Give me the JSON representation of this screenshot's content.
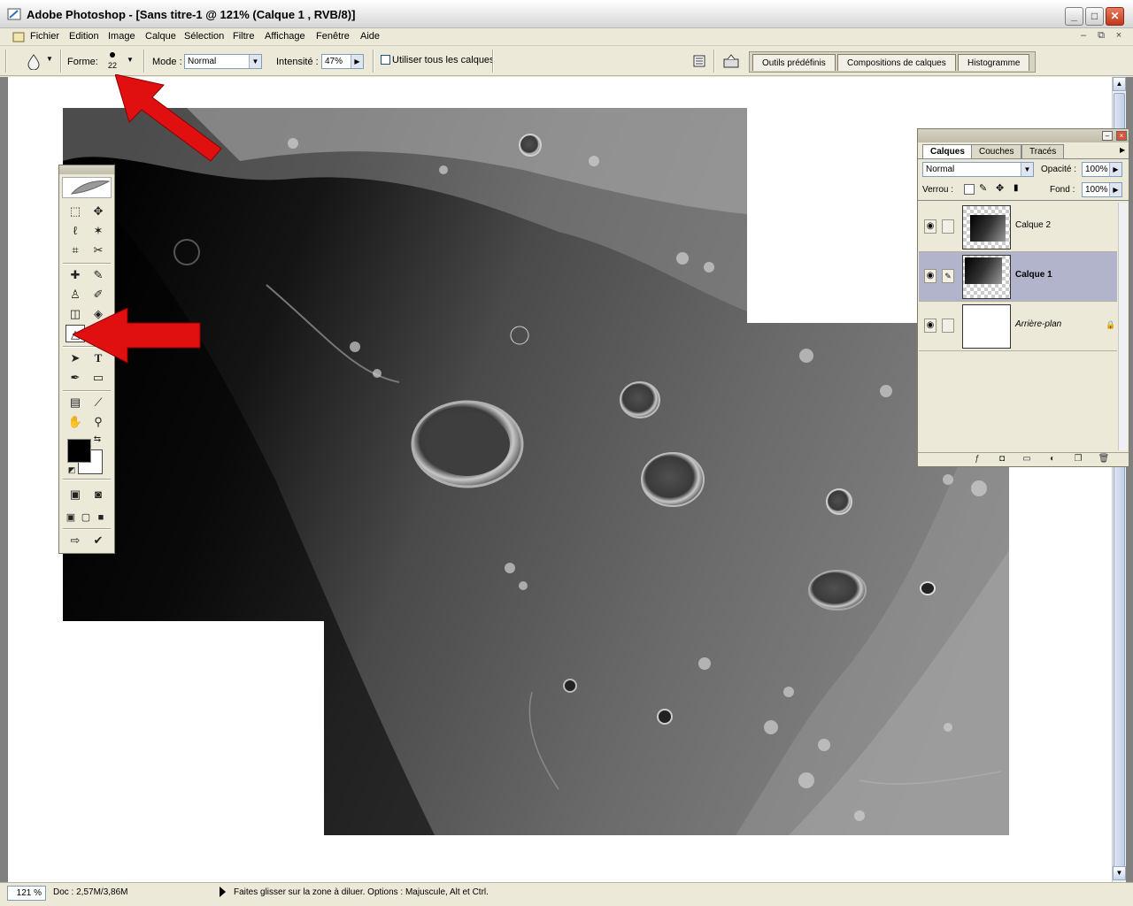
{
  "window": {
    "title": "Adobe Photoshop - [Sans titre-1 @ 121% (Calque 1 , RVB/8)]",
    "minimize": "_",
    "maximize": "□",
    "close": "✕"
  },
  "menu": {
    "items": [
      "Fichier",
      "Edition",
      "Image",
      "Calque",
      "Sélection",
      "Filtre",
      "Affichage",
      "Fenêtre",
      "Aide"
    ],
    "mdi_minimize": "–",
    "mdi_restore": "⧉",
    "mdi_close": "×"
  },
  "options": {
    "forme_label": "Forme:",
    "brush_size": "22",
    "mode_label": "Mode :",
    "mode_value": "Normal",
    "intensite_label": "Intensité :",
    "intensite_value": "47%",
    "sample_all_label": "Utiliser tous les calques",
    "well_tabs": [
      "Outils prédéfinis",
      "Compositions de calques",
      "Histogramme"
    ]
  },
  "layers_palette": {
    "tabs": [
      "Calques",
      "Couches",
      "Tracés"
    ],
    "blend_mode": "Normal",
    "opacity_label": "Opacité :",
    "opacity_value": "100%",
    "lock_label": "Verrou :",
    "fill_label": "Fond :",
    "fill_value": "100%",
    "layers": [
      {
        "name": "Calque 2",
        "selected": false
      },
      {
        "name": "Calque 1",
        "selected": true
      },
      {
        "name": "Arrière-plan",
        "selected": false
      }
    ]
  },
  "status": {
    "zoom": "121 %",
    "doc": "Doc : 2,57M/3,86M",
    "hint": "Faites glisser sur la zone à diluer. Options : Majuscule, Alt et Ctrl."
  },
  "icons": {
    "eye": "👁",
    "brush": "✎",
    "lock": "🔒"
  },
  "colors": {
    "foreground": "#000000",
    "background": "#ffffff",
    "annotation_arrow": "#e01010",
    "selected_layer": "#b2b4cc"
  }
}
